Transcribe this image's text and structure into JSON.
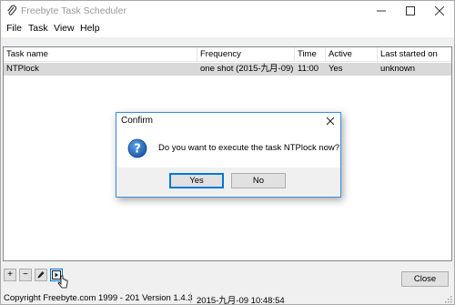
{
  "window": {
    "title": "Freebyte Task Scheduler",
    "icon": "paperclip-icon"
  },
  "menu": {
    "file": "File",
    "task": "Task",
    "view": "View",
    "help": "Help"
  },
  "table": {
    "headers": {
      "name": "Task name",
      "frequency": "Frequency",
      "time": "Time",
      "active": "Active",
      "last": "Last started on"
    },
    "rows": [
      {
        "name": "NTPlock",
        "frequency": "one shot (2015-九月-09)",
        "time": "11:00",
        "active": "Yes",
        "last": "unknown"
      }
    ]
  },
  "dialog": {
    "title": "Confirm",
    "message": "Do you want to execute the task NTPlock now?",
    "yes_label": "Yes",
    "no_label": "No",
    "icon": "question-icon"
  },
  "toolbar": {
    "add_label": "+",
    "remove_label": "−",
    "close_label": "Close"
  },
  "status": {
    "copyright": "Copyright Freebyte.com 1999 - 201 Version 1.4.3",
    "datetime": "2015-九月-09 10:48:54"
  },
  "colors": {
    "accent": "#0078d7",
    "selected_row": "#d9d9d9",
    "dialog_border": "#3b8fd6"
  }
}
